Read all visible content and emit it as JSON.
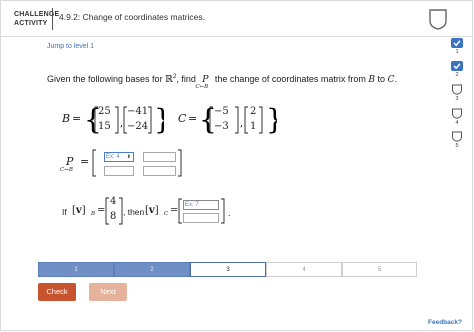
{
  "header": {
    "challenge_line1": "CHALLENGE",
    "challenge_line2": "ACTIVITY",
    "title": "4.9.2: Change of coordinates matrices."
  },
  "levels": [
    {
      "num": "1",
      "state": "done"
    },
    {
      "num": "2",
      "state": "done"
    },
    {
      "num": "3",
      "state": "current"
    },
    {
      "num": "4",
      "state": "todo"
    },
    {
      "num": "5",
      "state": "todo"
    }
  ],
  "jump_link": "Jump to level 1",
  "prompt": {
    "part1": "Given the following bases for ",
    "space": "ℝ",
    "exp": "2",
    "part2": ", find ",
    "p": "P",
    "p_sub": "C←B",
    "part3": " the change of coordinates matrix from ",
    "from": "B",
    "part4": " to ",
    "to": "C",
    "part5": "."
  },
  "basis_B": {
    "label": "B",
    "v1": [
      "25",
      "15"
    ],
    "v2": [
      "−41",
      "−24"
    ]
  },
  "basis_C": {
    "label": "C",
    "v1": [
      "−5",
      "−3"
    ],
    "v2": [
      "2",
      "1"
    ]
  },
  "p_matrix": {
    "p": "P",
    "sub": "C←B",
    "placeholder": "Ex: 4"
  },
  "question2": {
    "if": "If ",
    "v": "v",
    "sub_b": "B",
    "vec": [
      "4",
      "8"
    ],
    "then": ", then ",
    "sub_c": "C",
    "placeholder": "Ex: 7"
  },
  "progress": [
    "1",
    "2",
    "3",
    "4",
    "5"
  ],
  "buttons": {
    "check": "Check",
    "next": "Next"
  },
  "feedback": "Feedback?",
  "colors": {
    "accent": "#3b73c0",
    "check": "#c8542f",
    "next": "#e6b29c",
    "progress_done": "#6f8fc6"
  }
}
